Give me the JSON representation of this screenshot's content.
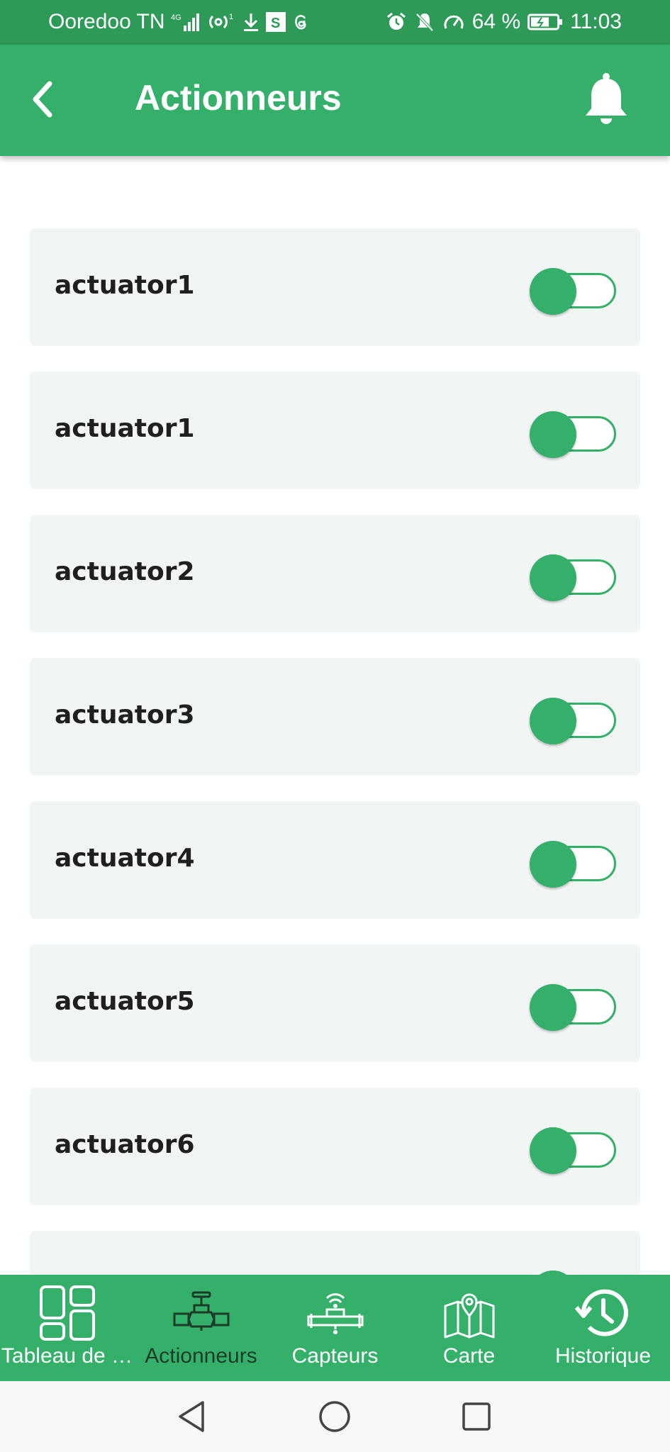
{
  "status_bar": {
    "carrier": "Ooredoo TN",
    "network": "4G",
    "hotspot_count": "1",
    "battery": "64 %",
    "time": "11:03"
  },
  "header": {
    "title": "Actionneurs",
    "back_icon": "chevron-left-icon",
    "notification_icon": "bell-icon"
  },
  "actuators": [
    {
      "label": "actuator1",
      "state": "off"
    },
    {
      "label": "actuator1",
      "state": "off"
    },
    {
      "label": "actuator2",
      "state": "off"
    },
    {
      "label": "actuator3",
      "state": "off"
    },
    {
      "label": "actuator4",
      "state": "off"
    },
    {
      "label": "actuator5",
      "state": "off"
    },
    {
      "label": "actuator6",
      "state": "off"
    },
    {
      "label": "",
      "state": "off"
    }
  ],
  "bottom_nav": {
    "items": [
      {
        "label": "Tableau de …",
        "icon": "dashboard-icon",
        "active": false
      },
      {
        "label": "Actionneurs",
        "icon": "valve-icon",
        "active": true
      },
      {
        "label": "Capteurs",
        "icon": "sensor-icon",
        "active": false
      },
      {
        "label": "Carte",
        "icon": "map-icon",
        "active": false
      },
      {
        "label": "Historique",
        "icon": "history-icon",
        "active": false
      }
    ]
  },
  "colors": {
    "status_bar": "#2e9a58",
    "primary": "#35b06a",
    "card_background": "#f1f5f4",
    "active_nav_label": "#1a3b27"
  }
}
